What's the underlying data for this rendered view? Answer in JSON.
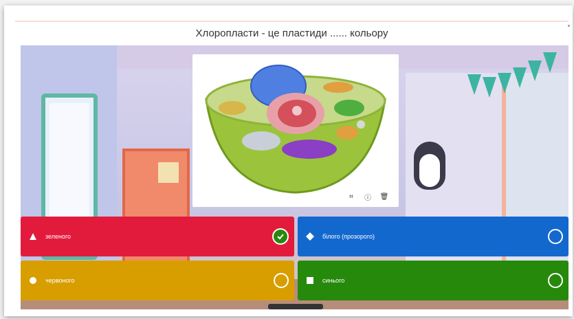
{
  "question": {
    "text": "Хлоропласти - це пластиди ...... кольору"
  },
  "answers": [
    {
      "label": "зеленого",
      "shape": "triangle-icon",
      "color": "#e21b3c",
      "correct": true
    },
    {
      "label": "білого (прозорого)",
      "shape": "diamond-icon",
      "color": "#1368ce",
      "correct": false
    },
    {
      "label": "червоного",
      "shape": "circle-icon",
      "color": "#d89e00",
      "correct": false
    },
    {
      "label": "синього",
      "shape": "square-icon",
      "color": "#26890c",
      "correct": false
    }
  ],
  "image_tools": [
    "crop-icon",
    "info-icon",
    "trash-icon"
  ],
  "colors": {
    "accent_line": "#f6dcd4",
    "check_green": "#26890c"
  }
}
